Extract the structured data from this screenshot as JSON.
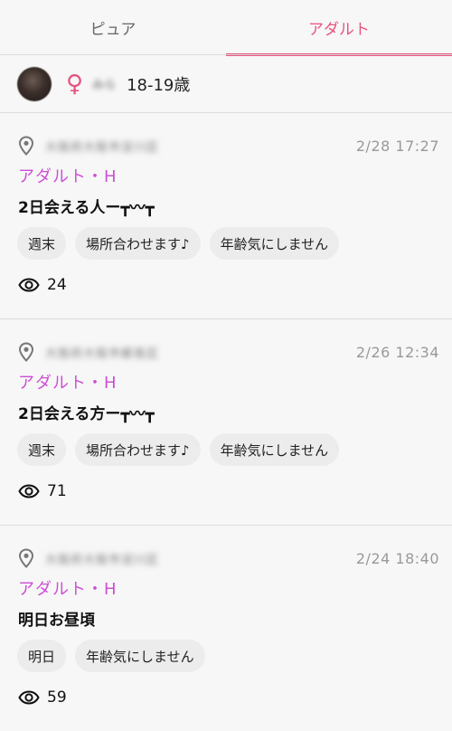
{
  "tabs": [
    {
      "label": "ピュア",
      "active": false
    },
    {
      "label": "アダルト",
      "active": true
    }
  ],
  "profile": {
    "gender_symbol": "♀",
    "name": "みら",
    "age": "18-19歳"
  },
  "colors": {
    "accent": "#e8537f",
    "category": "#cc4fd4"
  },
  "icons": {
    "location": "map-pin-icon",
    "views": "eye-icon"
  },
  "posts": [
    {
      "location": "大阪府大阪市淀川区",
      "date": "2/28 17:27",
      "category": "アダルト・H",
      "title": "2日会える人ー┳〰┳",
      "tags": [
        "週末",
        "場所合わせます♪",
        "年齢気にしません"
      ],
      "views": "24"
    },
    {
      "location": "大阪府大阪市都島区",
      "date": "2/26 12:34",
      "category": "アダルト・H",
      "title": "2日会える方ー┳〰┳",
      "tags": [
        "週末",
        "場所合わせます♪",
        "年齢気にしません"
      ],
      "views": "71"
    },
    {
      "location": "大阪府大阪市淀川区",
      "date": "2/24 18:40",
      "category": "アダルト・H",
      "title": "明日お昼頃",
      "tags": [
        "明日",
        "年齢気にしません"
      ],
      "views": "59"
    }
  ]
}
